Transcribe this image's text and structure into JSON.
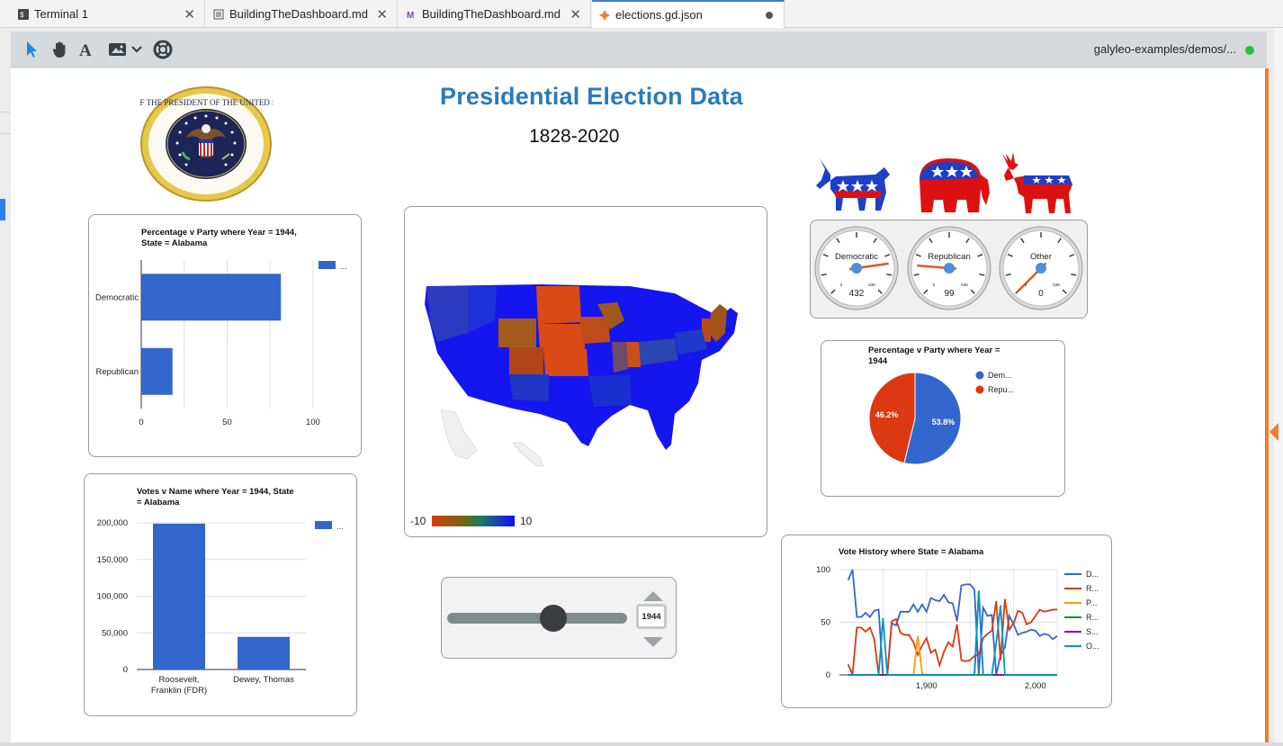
{
  "tabs": [
    {
      "label": "Terminal 1",
      "icon": "terminal-icon"
    },
    {
      "label": "BuildingTheDashboard.md",
      "icon": "document-icon"
    },
    {
      "label": "BuildingTheDashboard.md",
      "icon": "markdown-icon"
    },
    {
      "label": "elections.gd.json",
      "icon": "galyleo-icon"
    }
  ],
  "toolbar": {
    "path_label": "galyleo-examples/demos/...",
    "status_color": "#22c43a",
    "tools": [
      "pointer-icon",
      "hand-icon",
      "text-icon",
      "image-icon",
      "chevron-down-icon",
      "lifebuoy-icon"
    ]
  },
  "dashboard": {
    "title": "Presidential Election Data",
    "subtitle": "1828-2020",
    "seal_text": "SEAL OF THE PRESIDENT OF THE UNITED STATES",
    "colors": {
      "accent": "#2b7bbb",
      "democratic": "#3366cc",
      "republican": "#dc3912",
      "canvas_orange": "#f07c2c"
    }
  },
  "party_bar": {
    "title_line1": "Percentage v Party where Year = 1944,",
    "title_line2": "State = Alabama",
    "legend": "...",
    "chart_data": {
      "type": "bar",
      "orientation": "horizontal",
      "categories": [
        "Democratic",
        "Republican"
      ],
      "values": [
        81.3,
        18.2
      ],
      "xlim": [
        0,
        110
      ],
      "xticks": [
        "0",
        "50",
        "100"
      ]
    }
  },
  "votes_bar": {
    "title_line1": "Votes v Name where Year = 1944, State",
    "title_line2": "= Alabama",
    "legend": "...",
    "chart_data": {
      "type": "bar",
      "categories": [
        [
          "Roosevelt,",
          "Franklin (FDR)"
        ],
        [
          "Dewey, Thomas"
        ]
      ],
      "values": [
        198918,
        44540
      ],
      "ylim": [
        0,
        200000
      ],
      "yticks": [
        "200,000",
        "150,000",
        "100,000",
        "50,000",
        "0"
      ]
    }
  },
  "map": {
    "legend_min": "-10",
    "legend_max": "10"
  },
  "year_slider": {
    "value": "1944",
    "fraction": 0.59
  },
  "gauges": [
    {
      "label": "Democratic",
      "value": "432",
      "min": "0",
      "max": "538"
    },
    {
      "label": "Republican",
      "value": "99",
      "min": "0",
      "max": "538"
    },
    {
      "label": "Other",
      "value": "0",
      "min": "0",
      "max": "538"
    }
  ],
  "pie": {
    "title_line1": "Percentage v Party where Year =",
    "title_line2": "1944",
    "chart_data": {
      "type": "pie",
      "slices": [
        {
          "label": "Dem...",
          "value": 53.8,
          "text": "53.8%",
          "color": "#3366cc"
        },
        {
          "label": "Repu...",
          "value": 46.2,
          "text": "46.2%",
          "color": "#dc3912"
        }
      ]
    }
  },
  "history": {
    "title": "Vote History where State = Alabama",
    "chart_data": {
      "type": "line",
      "xlim": [
        1820,
        2020
      ],
      "ylim": [
        0,
        100
      ],
      "xticks": [
        "1,900",
        "2,000"
      ],
      "yticks": [
        "100",
        "50",
        "0"
      ],
      "x": [
        1828,
        1832,
        1836,
        1840,
        1844,
        1848,
        1852,
        1856,
        1860,
        1864,
        1868,
        1872,
        1876,
        1880,
        1884,
        1888,
        1892,
        1896,
        1900,
        1904,
        1908,
        1912,
        1916,
        1920,
        1924,
        1928,
        1932,
        1936,
        1940,
        1944,
        1948,
        1952,
        1956,
        1960,
        1964,
        1968,
        1972,
        1976,
        1980,
        1984,
        1988,
        1992,
        1996,
        2000,
        2004,
        2008,
        2012,
        2016,
        2020
      ],
      "series": [
        {
          "name": "D...",
          "color": "#3366cc",
          "values": [
            90,
            100,
            55,
            55,
            59,
            55,
            61,
            62,
            0,
            0,
            49,
            47,
            60,
            60,
            60,
            67,
            60,
            67,
            60,
            73,
            71,
            70,
            76,
            69,
            68,
            51,
            85,
            86,
            86,
            81,
            0,
            64,
            56,
            57,
            0,
            19,
            26,
            56,
            48,
            38,
            40,
            41,
            43,
            42,
            37,
            39,
            38,
            34,
            37
          ]
        },
        {
          "name": "R...",
          "color": "#dc3912",
          "values": [
            10,
            0,
            45,
            45,
            41,
            45,
            34,
            0,
            0,
            0,
            51,
            53,
            40,
            38,
            38,
            31,
            19,
            28,
            35,
            21,
            24,
            9,
            22,
            31,
            27,
            48,
            14,
            13,
            14,
            18,
            19,
            35,
            39,
            42,
            70,
            14,
            72,
            43,
            49,
            61,
            59,
            48,
            50,
            56,
            62,
            60,
            61,
            62,
            62
          ]
        },
        {
          "name": "P...",
          "color": "#ff9900",
          "values": [
            0,
            0,
            0,
            0,
            0,
            0,
            0,
            0,
            0,
            0,
            0,
            0,
            0,
            0,
            0,
            0,
            37,
            1,
            0,
            0,
            0,
            0,
            0,
            0,
            0,
            0,
            0,
            0,
            0,
            0,
            0,
            0,
            0,
            0,
            0,
            0,
            0,
            0,
            0,
            0,
            0,
            0,
            0,
            0,
            0,
            0,
            0,
            0,
            0
          ]
        },
        {
          "name": "R...",
          "color": "#109618",
          "values": [
            0,
            0,
            0,
            0,
            0,
            0,
            0,
            0,
            0,
            0,
            0,
            0,
            0,
            0,
            0,
            0,
            0,
            0,
            0,
            0,
            0,
            0,
            0,
            0,
            0,
            0,
            0,
            0,
            0,
            0,
            0,
            0,
            0,
            0,
            0,
            0,
            0,
            0,
            0,
            0,
            0,
            0,
            0,
            0,
            0,
            0,
            0,
            0,
            0
          ]
        },
        {
          "name": "S...",
          "color": "#990099",
          "values": [
            0,
            0,
            0,
            0,
            0,
            0,
            0,
            0,
            0,
            0,
            0,
            0,
            0,
            0,
            0,
            0,
            0,
            0,
            0,
            0,
            0,
            0,
            0,
            0,
            0,
            0,
            0,
            0,
            0,
            0,
            80,
            0,
            0,
            0,
            0,
            0,
            0,
            0,
            0,
            0,
            0,
            0,
            0,
            0,
            0,
            0,
            0,
            0,
            0
          ]
        },
        {
          "name": "O...",
          "color": "#0099c6",
          "values": [
            0,
            0,
            0,
            0,
            0,
            0,
            0,
            0,
            54,
            0,
            0,
            0,
            0,
            0,
            0,
            0,
            0,
            0,
            0,
            0,
            0,
            0,
            0,
            0,
            0,
            0,
            0,
            0,
            0,
            0,
            80,
            0,
            0,
            0,
            30,
            66,
            0,
            0,
            0,
            0,
            0,
            0,
            0,
            0,
            0,
            0,
            0,
            0,
            0
          ]
        }
      ]
    }
  }
}
